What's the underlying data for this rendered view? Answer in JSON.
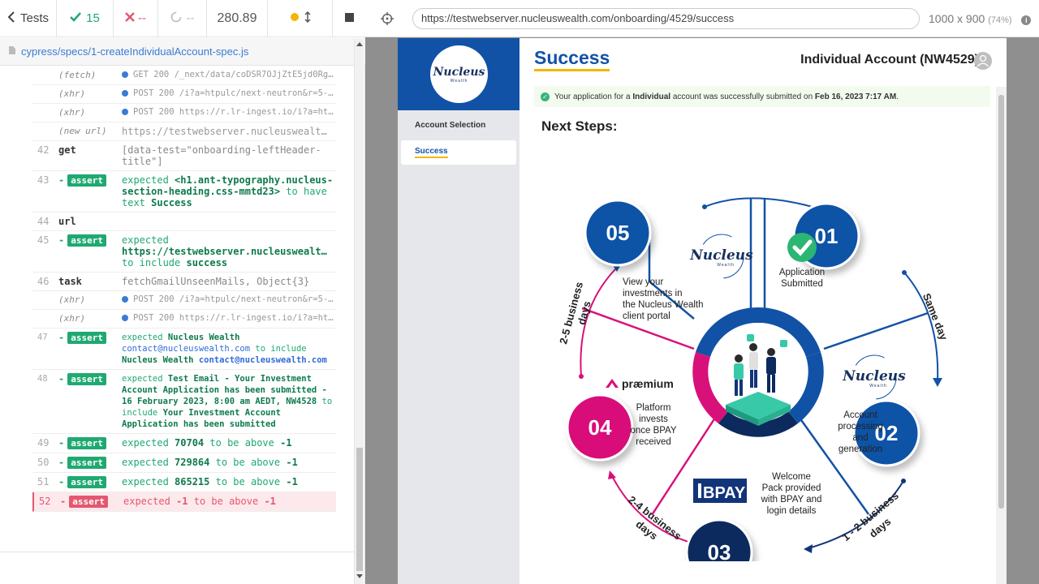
{
  "runner": {
    "tests_label": "Tests",
    "passed": "15",
    "failed": "--",
    "pending": "--",
    "duration": "280.89",
    "spec_path": "cypress/specs/1-createIndividualAccount-spec.js"
  },
  "log": [
    {
      "num": "",
      "cmd": "(fetch)",
      "msg": "GET 200 /_next/data/coDSR7OJjZtE5jd0Rg…",
      "kind": "xhr"
    },
    {
      "num": "",
      "cmd": "(xhr)",
      "msg": "POST 200 /i?a=htpulc/next-neutron&r=5-…",
      "kind": "xhr"
    },
    {
      "num": "",
      "cmd": "(xhr)",
      "msg": "POST 200 https://r.lr-ingest.io/i?a=ht…",
      "kind": "xhr"
    },
    {
      "num": "",
      "cmd": "(new url)",
      "msg": "https://testwebserver.nucleuswealt…",
      "kind": "newurl"
    },
    {
      "num": "42",
      "cmd": "get",
      "msg": "[data-test=\"onboarding-leftHeader-title\"]",
      "kind": "plain"
    },
    {
      "num": "43",
      "cmd": "assert",
      "pre": "expected",
      "a": "<h1.ant-typography.nucleus-section-heading.css-mmtd23>",
      "mid": "to have text",
      "b": "Success",
      "kind": "assert"
    },
    {
      "num": "44",
      "cmd": "url",
      "msg": "",
      "kind": "plain"
    },
    {
      "num": "45",
      "cmd": "assert",
      "pre": "expected",
      "a": "https://testwebserver.nucleuswealt…",
      "mid": "to include",
      "b": "success",
      "kind": "assert"
    },
    {
      "num": "46",
      "cmd": "task",
      "msg": "fetchGmailUnseenMails, Object{3}",
      "kind": "plain"
    },
    {
      "num": "",
      "cmd": "(xhr)",
      "msg": "POST 200 /i?a=htpulc/next-neutron&r=5-…",
      "kind": "xhr"
    },
    {
      "num": "",
      "cmd": "(xhr)",
      "msg": "POST 200 https://r.lr-ingest.io/i?a=ht…",
      "kind": "xhr"
    }
  ],
  "log_small": [
    {
      "num": "47",
      "pre": "expected",
      "a1": "Nucleus Wealth",
      "a2": "contact@nucleuswealth.com",
      "mid": "to include",
      "b1": "Nucleus Wealth",
      "b2": "contact@nucleuswealth.com"
    },
    {
      "num": "48",
      "pre": "expected",
      "a1": "Test Email - Your Investment Account Application has been submitted - 16 February 2023, 8:00 am AEDT, NW4528",
      "mid": "to include",
      "b1": "Your Investment Account Application has been submitted"
    }
  ],
  "log_tail": [
    {
      "num": "49",
      "pre": "expected",
      "a": "70704",
      "mid": "to be above",
      "b": "-1",
      "fail": false
    },
    {
      "num": "50",
      "pre": "expected",
      "a": "729864",
      "mid": "to be above",
      "b": "-1",
      "fail": false
    },
    {
      "num": "51",
      "pre": "expected",
      "a": "865215",
      "mid": "to be above",
      "b": "-1",
      "fail": false
    },
    {
      "num": "52",
      "pre": "expected",
      "a": "-1",
      "mid": "to be above",
      "b": "-1",
      "fail": true
    }
  ],
  "assert_label": "assert",
  "browser": {
    "url": "https://testwebserver.nucleuswealth.com/onboarding/4529/success",
    "viewport": "1000 x 900",
    "scale": "(74%)"
  },
  "app": {
    "logo_text": "Nucleus",
    "logo_sub": "Wealth",
    "sidebar": [
      {
        "label": "Account Selection"
      },
      {
        "label": "Success"
      }
    ],
    "page_title": "Success",
    "account_title": "Individual Account (NW4529)",
    "banner": {
      "t1": "Your application for a",
      "t2": "Individual",
      "t3": "account was successfully submitted on",
      "t4": "Feb 16, 2023 7:17 AM",
      "t5": "."
    },
    "next_steps": "Next Steps:"
  },
  "graphic": {
    "steps": [
      {
        "n": "01"
      },
      {
        "n": "02"
      },
      {
        "n": "03"
      },
      {
        "n": "04"
      },
      {
        "n": "05"
      }
    ],
    "labels": {
      "app_submitted_1": "Application",
      "app_submitted_2": "Submitted",
      "acct_proc_1": "Account",
      "acct_proc_2": "processing",
      "acct_proc_3": "and",
      "acct_proc_4": "generation",
      "welcome_1": "Welcome",
      "welcome_2": "Pack provided",
      "welcome_3": "with BPAY and",
      "welcome_4": "login details",
      "platform_1": "Platform",
      "platform_2": "invests",
      "platform_3": "once BPAY",
      "platform_4": "received",
      "view_1": "View your",
      "view_2": "investments in",
      "view_3": "the Nucleus Wealth",
      "view_4": "client portal",
      "same_day": "Same day",
      "one_two": "1 - 2 business",
      "one_two_b": "days",
      "two_four": "2-4 business",
      "two_four_b": "days",
      "two_five": "2-5 business",
      "two_five_b": "days",
      "praemium": "præmium",
      "bpay": "BPAY",
      "nucleus": "Nucleus",
      "wealth": "Wealth"
    },
    "colors": {
      "dark_blue": "#12347a",
      "mid_blue": "#1152a6",
      "navy": "#0c2a5e",
      "magenta": "#d8107a",
      "green": "#2bb673",
      "teal": "#38c9a8"
    }
  }
}
